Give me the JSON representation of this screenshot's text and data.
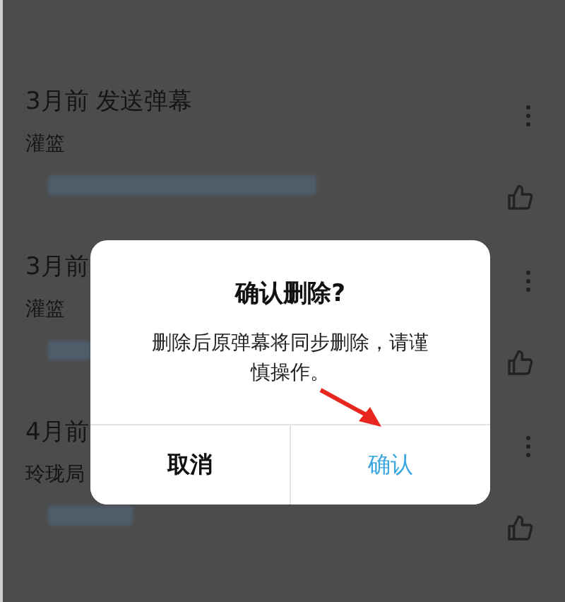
{
  "items": [
    {
      "title": "3月前 发送弹幕",
      "name": "灌篮"
    },
    {
      "title": "3月前",
      "name": "灌篮"
    },
    {
      "title": "4月前",
      "name": "玲珑局"
    }
  ],
  "dialog": {
    "title": "确认删除?",
    "message": "删除后原弹幕将同步删除，请谨慎操作。",
    "buttons": [
      {
        "label": "取消",
        "kind": "cancel"
      },
      {
        "label": "确认",
        "kind": "confirm"
      }
    ]
  }
}
